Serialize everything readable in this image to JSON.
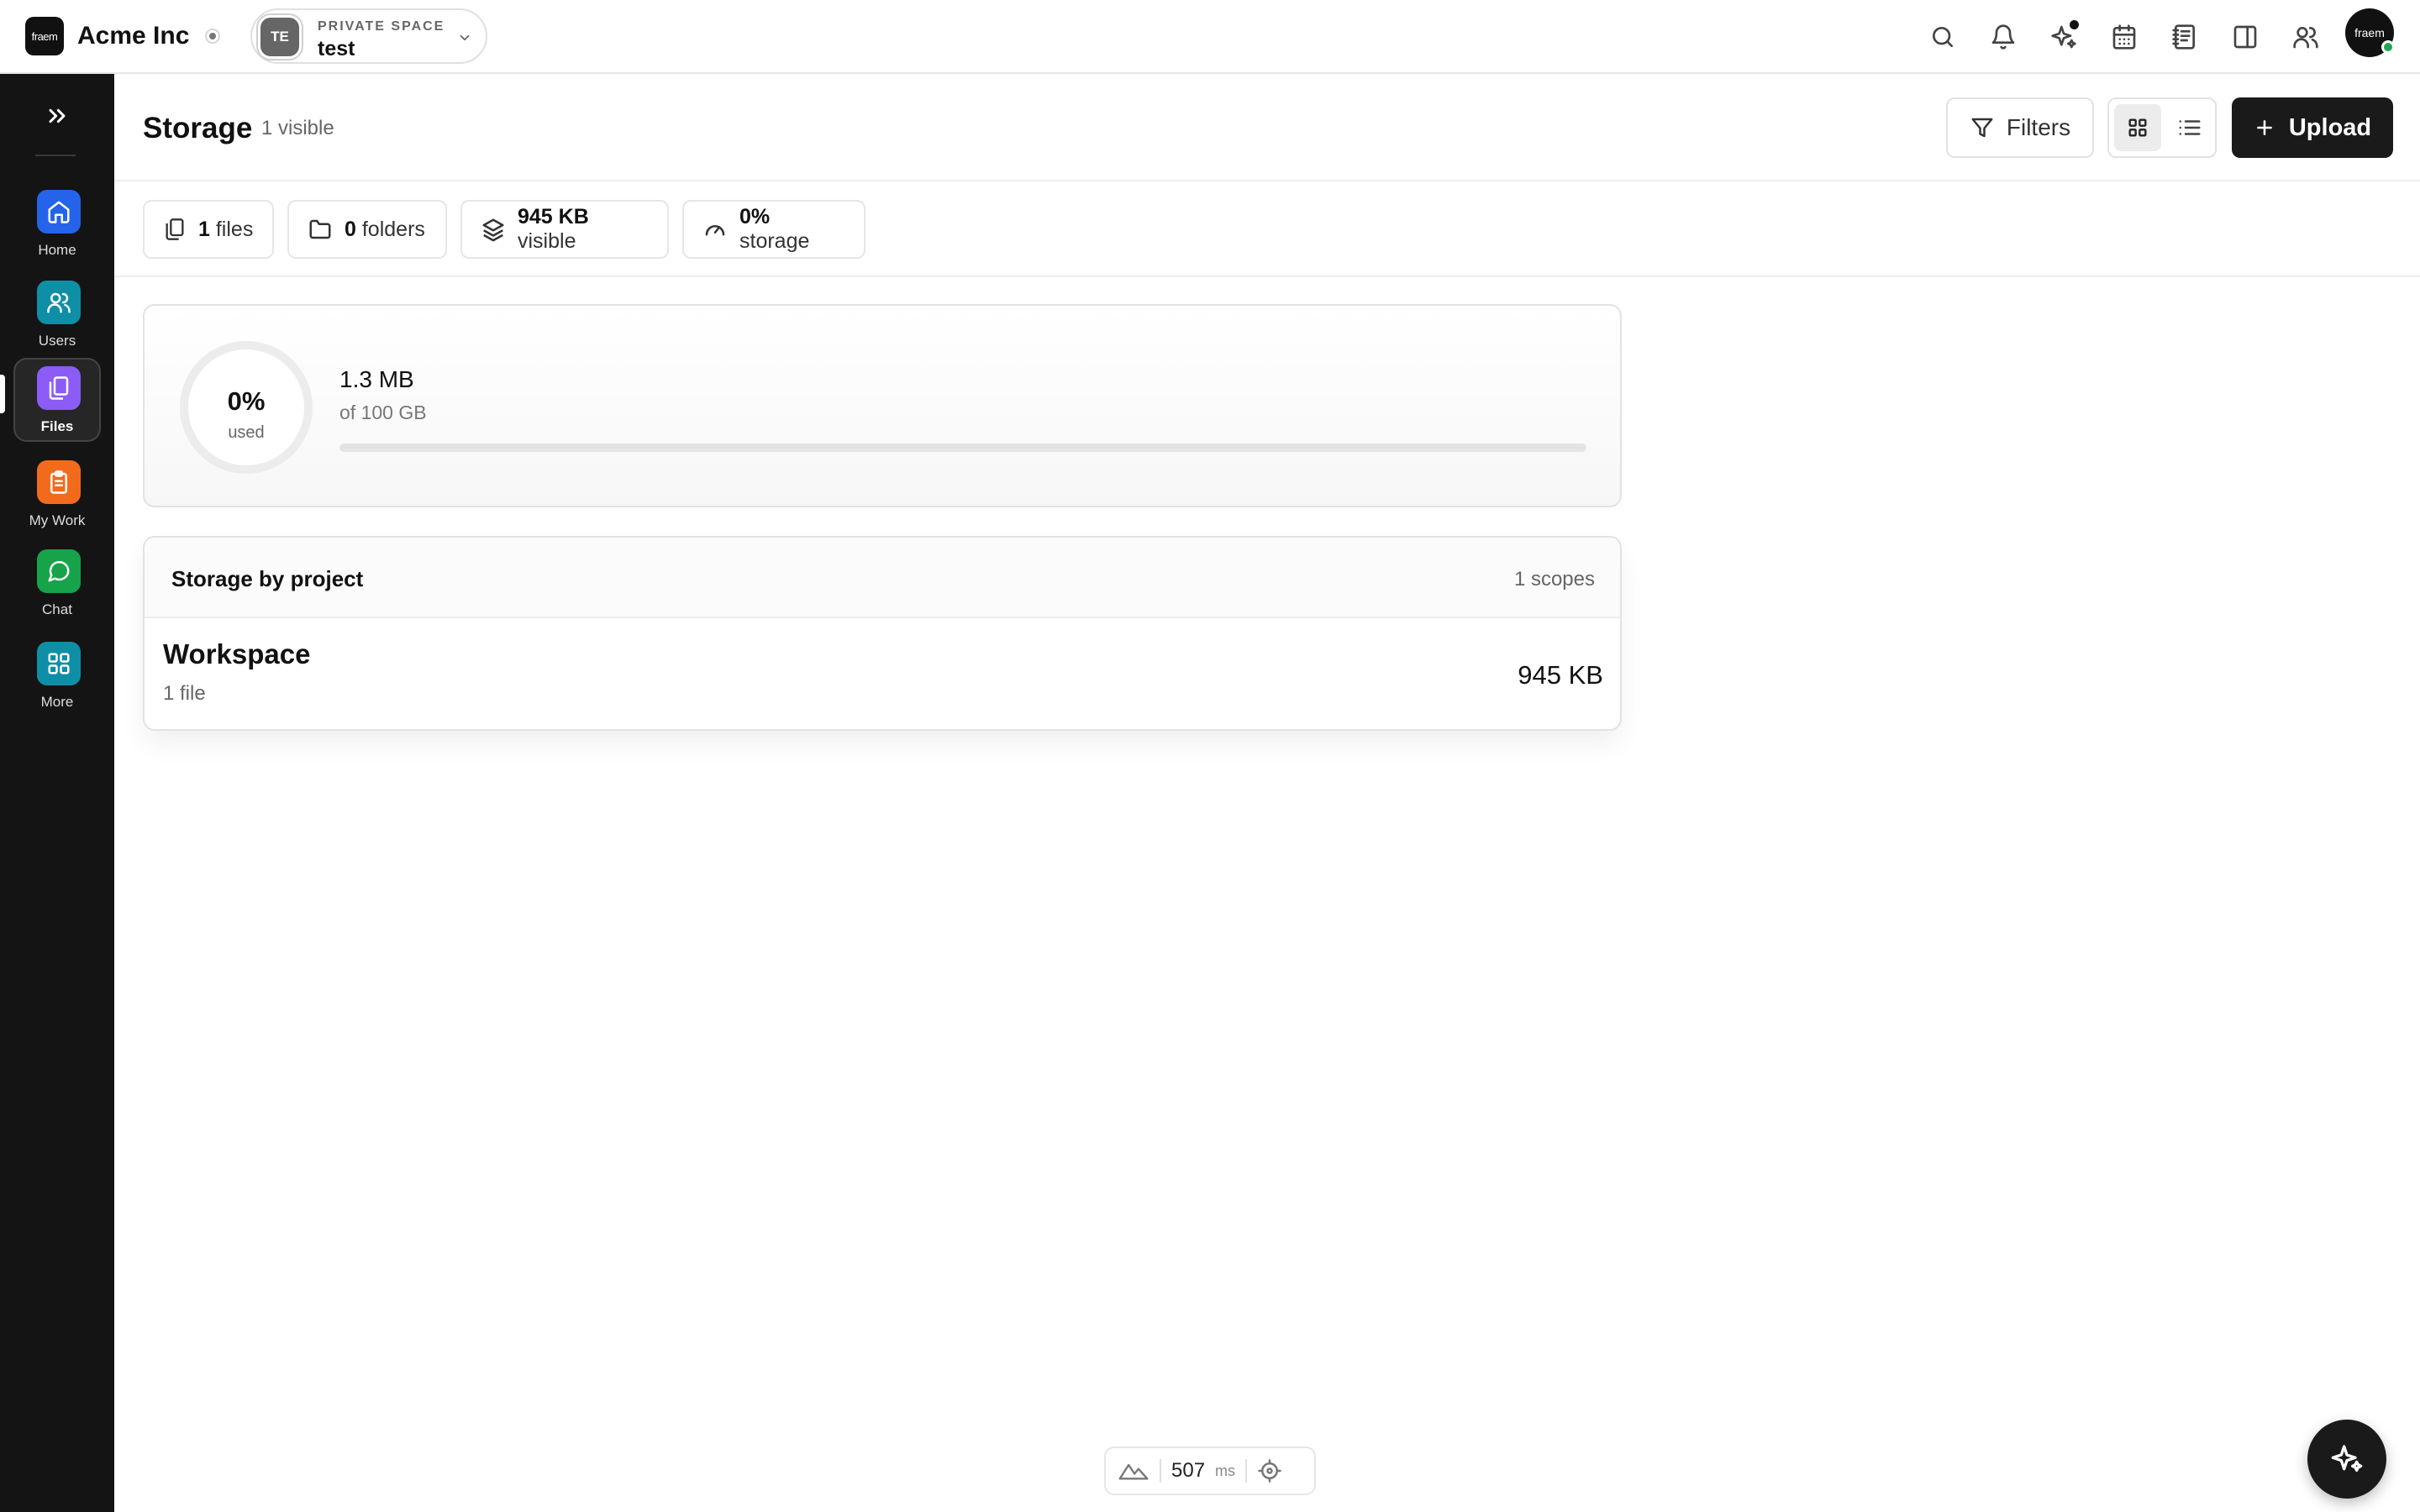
{
  "app": {
    "brand_logo_text": "fraem",
    "brand_name": "Acme Inc",
    "space_label": "PRIVATE SPACE",
    "space_name": "test",
    "space_initials": "TE",
    "user_avatar_text": "fraem"
  },
  "topbar_icons": [
    "search-icon",
    "bell-icon",
    "sparkles-icon",
    "calendar-icon",
    "notebook-icon",
    "panel-icon",
    "people-icon"
  ],
  "sidebar": {
    "items": [
      {
        "label": "Home",
        "icon": "home-icon",
        "color": "#2563eb"
      },
      {
        "label": "Users",
        "icon": "users-icon",
        "color": "#0e8fa6"
      },
      {
        "label": "Files",
        "icon": "files-icon",
        "color": "#8b5cf6"
      },
      {
        "label": "My Work",
        "icon": "clipboard-icon",
        "color": "#f26b1d"
      },
      {
        "label": "Chat",
        "icon": "chat-icon",
        "color": "#16a34a"
      },
      {
        "label": "More",
        "icon": "grid-icon",
        "color": "#0e8fa6"
      }
    ]
  },
  "header": {
    "title": "Storage",
    "subtitle": "1 visible",
    "filters_label": "Filters",
    "upload_label": "Upload"
  },
  "stats": {
    "files_count": "1",
    "files_label": "files",
    "folders_count": "0",
    "folders_label": "folders",
    "size_value": "945 KB",
    "size_label": "visible",
    "storage_value": "0%",
    "storage_label": "storage"
  },
  "usage": {
    "percent_text": "0%",
    "used_label": "used",
    "used_amount": "1.3 MB",
    "total_text": "of 100 GB",
    "fill_fraction": 0
  },
  "projects": {
    "title": "Storage by project",
    "count_text": "1 scopes",
    "rows": [
      {
        "name": "Workspace",
        "files": "1 file",
        "size": "945 KB"
      }
    ]
  },
  "perf": {
    "ms_value": "507",
    "ms_unit": "ms"
  },
  "colors": {
    "accent": "#1a1a1a",
    "online": "#1fa84f"
  }
}
